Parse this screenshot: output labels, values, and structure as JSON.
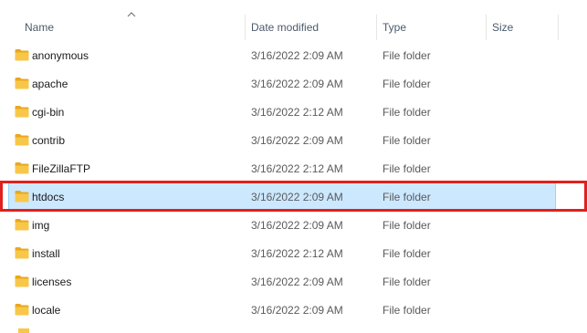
{
  "columns": {
    "name": "Name",
    "date_modified": "Date modified",
    "type": "Type",
    "size": "Size"
  },
  "sort": {
    "column": "name",
    "direction": "ascending",
    "icon": "sort-up-icon"
  },
  "folder_icon": {
    "name": "folder-icon",
    "color": "#f8c74a",
    "tab_color": "#e8a820"
  },
  "files": [
    {
      "name": "anonymous",
      "date": "3/16/2022 2:09 AM",
      "type": "File folder"
    },
    {
      "name": "apache",
      "date": "3/16/2022 2:09 AM",
      "type": "File folder"
    },
    {
      "name": "cgi-bin",
      "date": "3/16/2022 2:12 AM",
      "type": "File folder"
    },
    {
      "name": "contrib",
      "date": "3/16/2022 2:09 AM",
      "type": "File folder"
    },
    {
      "name": "FileZillaFTP",
      "date": "3/16/2022 2:12 AM",
      "type": "File folder"
    },
    {
      "name": "htdocs",
      "date": "3/16/2022 2:09 AM",
      "type": "File folder",
      "selected": true
    },
    {
      "name": "img",
      "date": "3/16/2022 2:09 AM",
      "type": "File folder"
    },
    {
      "name": "install",
      "date": "3/16/2022 2:12 AM",
      "type": "File folder"
    },
    {
      "name": "licenses",
      "date": "3/16/2022 2:09 AM",
      "type": "File folder"
    },
    {
      "name": "locale",
      "date": "3/16/2022 2:09 AM",
      "type": "File folder"
    }
  ],
  "colors": {
    "selection_bg": "#cce8ff",
    "highlight_box": "#e0201c"
  }
}
